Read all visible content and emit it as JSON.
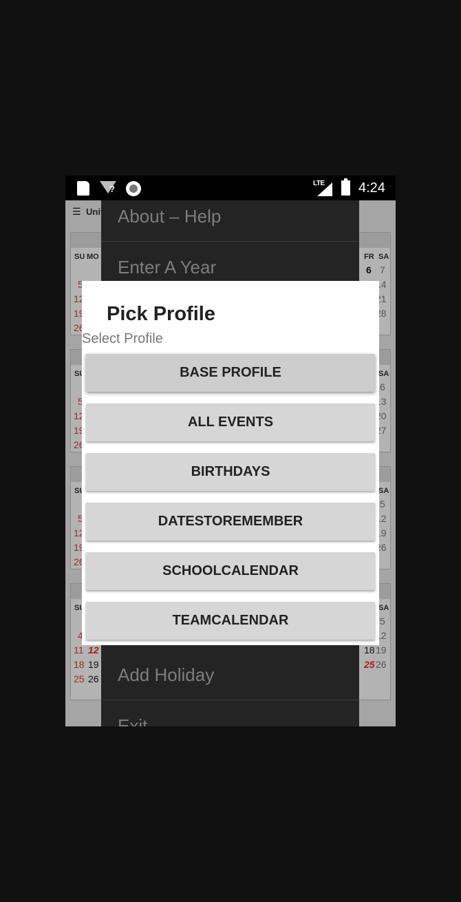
{
  "status_bar": {
    "wifi_unknown_mark": "?",
    "network_type": "LTE",
    "time": "4:24"
  },
  "calendar": {
    "title_partial": "Unit",
    "weekday_headers": [
      "SU",
      "MO"
    ],
    "right_weekday_headers": [
      "FR",
      "SA"
    ],
    "block1_left": [
      "5",
      "12",
      "19",
      "26"
    ],
    "block1_right_top": [
      "6",
      "7"
    ],
    "block1_right": [
      "14",
      "21",
      "28"
    ],
    "block2_left": [
      "5",
      "12",
      "19",
      "26"
    ],
    "block2_right": [
      "6",
      "13",
      "20",
      "27"
    ],
    "block3_left": [
      "5",
      "12",
      "19",
      "26"
    ],
    "block3_right": [
      "5",
      "12",
      "19",
      "26"
    ],
    "block4_left_su": [
      "4",
      "11",
      "18",
      "25"
    ],
    "block4_left_mo": [
      "12",
      "19",
      "26"
    ],
    "block4_right_fr": [
      "18",
      "25"
    ],
    "block4_right_sa": [
      "5",
      "12",
      "19",
      "26"
    ]
  },
  "drawer": {
    "items": [
      "About – Help",
      "Enter A Year",
      "Add Holiday",
      "Exit"
    ]
  },
  "dialog": {
    "title": "Pick Profile",
    "subtitle": "Select Profile",
    "profiles": [
      "BASE PROFILE",
      "ALL EVENTS",
      "BIRTHDAYS",
      "DATESTOREMEMBER",
      "SCHOOLCALENDAR",
      "TEAMCALENDAR"
    ]
  }
}
